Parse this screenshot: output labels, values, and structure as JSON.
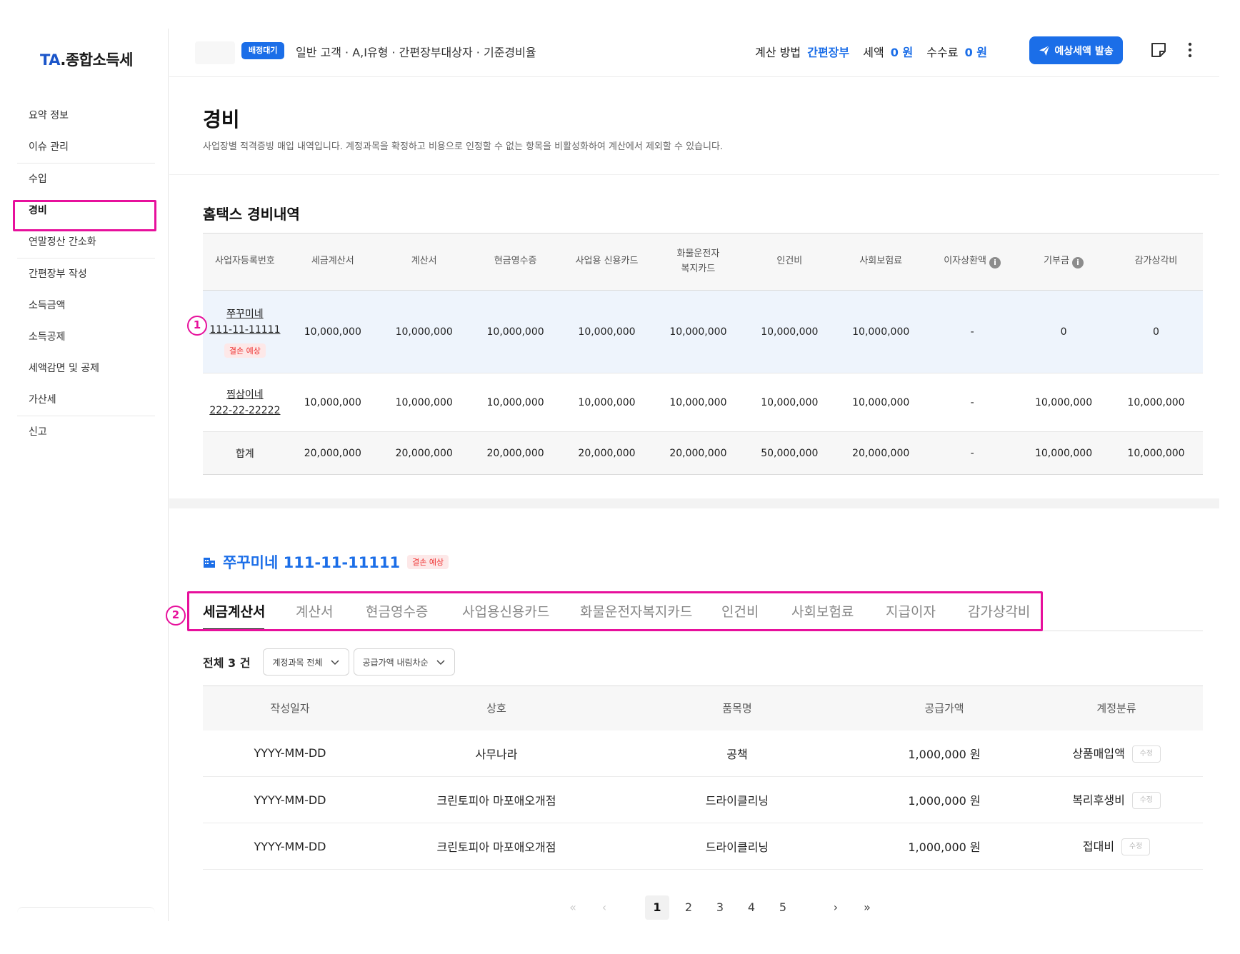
{
  "app": {
    "logo_prefix": "TA",
    "logo_dot": ".",
    "logo_text": "종합소득세"
  },
  "sidebar": {
    "items": [
      {
        "label": "요약 정보"
      },
      {
        "label": "이슈 관리"
      },
      {
        "label": "수입"
      },
      {
        "label": "경비"
      },
      {
        "label": "연말정산 간소화"
      },
      {
        "label": "간편장부 작성"
      },
      {
        "label": "소득금액"
      },
      {
        "label": "소득공제"
      },
      {
        "label": "세액감면 및 공제"
      },
      {
        "label": "가산세"
      },
      {
        "label": "신고"
      }
    ],
    "active": "경비"
  },
  "topbar": {
    "status_badge": "배정대기",
    "client_desc": "일반 고객 · A,I유형 · 간편장부대상자 · 기준경비율",
    "calc_method_label": "계산 방법",
    "calc_method_value": "간편장부",
    "tax_label": "세액",
    "tax_value": "0 원",
    "fee_label": "수수료",
    "fee_value": "0 원",
    "send_button": "예상세액 발송"
  },
  "page": {
    "title": "경비",
    "description": "사업장별 적격증빙 매입 내역입니다. 계정과목을 확정하고 비용으로 인정할 수 없는 항목을 비활성화하여 계산에서 제외할 수 있습니다."
  },
  "hometax": {
    "title": "홈택스 경비내역",
    "headers": [
      "사업자등록번호",
      "세금계산서",
      "계산서",
      "현금영수증",
      "사업용 신용카드",
      "화물운전자",
      "복지카드",
      "인건비",
      "사회보험료",
      "이자상환액",
      "기부금",
      "감가상각비"
    ],
    "rows": [
      {
        "name": "쭈꾸미네",
        "reg": "111-11-11111",
        "badge": "결손 예상",
        "values": [
          "10,000,000",
          "10,000,000",
          "10,000,000",
          "10,000,000",
          "10,000,000",
          "10,000,000",
          "10,000,000",
          "-",
          "0",
          "0"
        ]
      },
      {
        "name": "찜삼이네",
        "reg": "222-22-22222",
        "values": [
          "10,000,000",
          "10,000,000",
          "10,000,000",
          "10,000,000",
          "10,000,000",
          "10,000,000",
          "10,000,000",
          "-",
          "10,000,000",
          "10,000,000"
        ]
      }
    ],
    "total": {
      "label": "합계",
      "values": [
        "20,000,000",
        "20,000,000",
        "20,000,000",
        "20,000,000",
        "20,000,000",
        "50,000,000",
        "20,000,000",
        "-",
        "10,000,000",
        "10,000,000"
      ]
    }
  },
  "markers": {
    "one": "1",
    "two": "2"
  },
  "detail": {
    "title": "쭈꾸미네 111-11-11111",
    "badge": "결손 예상",
    "tabs": [
      "세금계산서",
      "계산서",
      "현금영수증",
      "사업용신용카드",
      "화물운전자복지카드",
      "인건비",
      "사회보험료",
      "지급이자",
      "감가상각비"
    ],
    "active_tab": "세금계산서",
    "count_label": "전체 3 건",
    "filter_account": "계정과목 전체",
    "filter_sort": "공급가액 내림차순",
    "columns": [
      "작성일자",
      "상호",
      "품목명",
      "공급가액",
      "계정분류"
    ],
    "rows": [
      {
        "date": "YYYY-MM-DD",
        "company": "사무나라",
        "item": "공책",
        "amount": "1,000,000 원",
        "account": "상품매입액",
        "edit": "수정"
      },
      {
        "date": "YYYY-MM-DD",
        "company": "크린토피아 마포애오개점",
        "item": "드라이클리닝",
        "amount": "1,000,000 원",
        "account": "복리후생비",
        "edit": "수정"
      },
      {
        "date": "YYYY-MM-DD",
        "company": "크린토피아 마포애오개점",
        "item": "드라이클리닝",
        "amount": "1,000,000 원",
        "account": "접대비",
        "edit": "수정"
      }
    ]
  },
  "pagination": {
    "pages": [
      "1",
      "2",
      "3",
      "4",
      "5"
    ],
    "current": "1"
  },
  "colors": {
    "accent": "#1b6ee8",
    "highlight": "#e7109c",
    "loss": "#e33333"
  }
}
